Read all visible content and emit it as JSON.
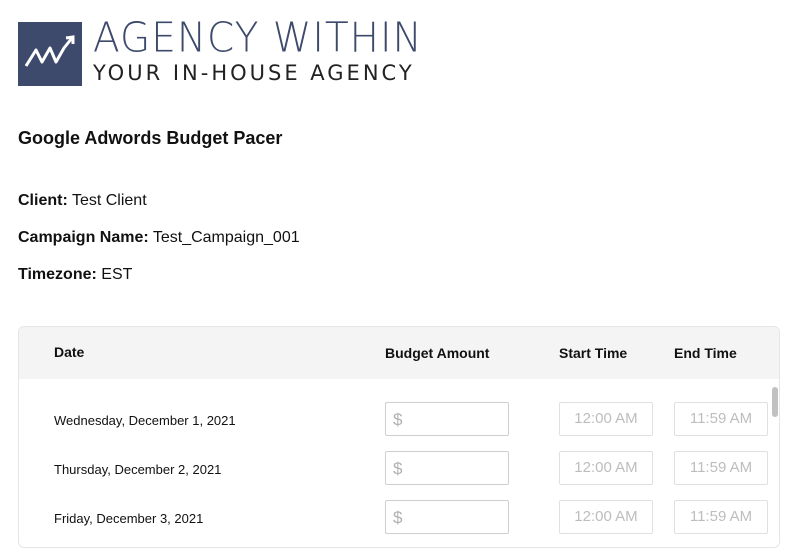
{
  "logo": {
    "line1": "AGENCY WITHIN",
    "line2": "YOUR IN-HOUSE AGENCY",
    "mark_color": "#3d4a6b"
  },
  "page_title": "Google Adwords Budget Pacer",
  "info": {
    "client_label": "Client:",
    "client_value": "Test Client",
    "campaign_label": "Campaign Name:",
    "campaign_value": "Test_Campaign_001",
    "timezone_label": "Timezone:",
    "timezone_value": "EST"
  },
  "table": {
    "headers": {
      "date": "Date",
      "budget": "Budget Amount",
      "start": "Start Time",
      "end": "End Time"
    },
    "rows": [
      {
        "date": "Wednesday, December 1, 2021",
        "currency": "$",
        "budget": "",
        "start": "12:00 AM",
        "end": "11:59 AM"
      },
      {
        "date": "Thursday, December 2, 2021",
        "currency": "$",
        "budget": "",
        "start": "12:00 AM",
        "end": "11:59 AM"
      },
      {
        "date": "Friday, December 3, 2021",
        "currency": "$",
        "budget": "",
        "start": "12:00 AM",
        "end": "11:59 AM"
      }
    ]
  }
}
